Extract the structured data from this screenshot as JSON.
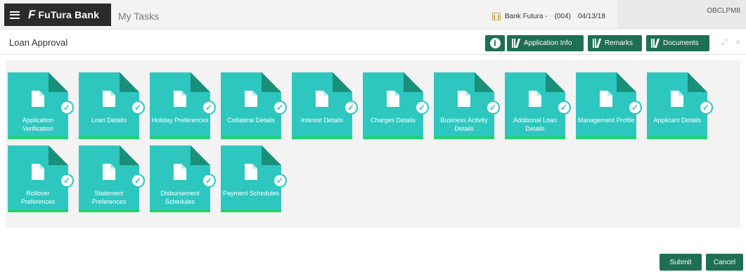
{
  "topbar": {
    "brand_mark": "F",
    "brand_name": "FuTura Bank",
    "tab": "My Tasks",
    "branch": "Bank Futura -",
    "branch_code": "(004)",
    "date": "04/13/18",
    "user": "OBCLPM8"
  },
  "header": {
    "title": "Loan Approval",
    "info_label": "i",
    "buttons": [
      "Application Info",
      "Remarks",
      "Documents"
    ],
    "minimize_glyph": "⤢",
    "close_glyph": "×"
  },
  "tiles": [
    {
      "label": "Application Verification"
    },
    {
      "label": "Loan Details"
    },
    {
      "label": "Holiday Preferences"
    },
    {
      "label": "Collateral Details"
    },
    {
      "label": "Interest Details"
    },
    {
      "label": "Charges Details"
    },
    {
      "label": "Business Activity Details"
    },
    {
      "label": "Additional Loan Details"
    },
    {
      "label": "Management Profile"
    },
    {
      "label": "Applicant Details"
    },
    {
      "label": "Rollover Preferences"
    },
    {
      "label": "Statement Preferences"
    },
    {
      "label": "Disbursement Schedules"
    },
    {
      "label": "Payment Schedules"
    }
  ],
  "footer": {
    "submit": "Submit",
    "cancel": "Cancel"
  },
  "colors": {
    "tile": "#2ec7c0",
    "tile_fold": "#1a8f79",
    "tile_bar": "#20d36a",
    "button": "#1f6f52"
  },
  "icons": {
    "menu": "hamburger-icon",
    "bank": "bank-icon",
    "info": "info-icon",
    "library": "library-icon",
    "document": "document-icon",
    "check": "check-icon"
  }
}
